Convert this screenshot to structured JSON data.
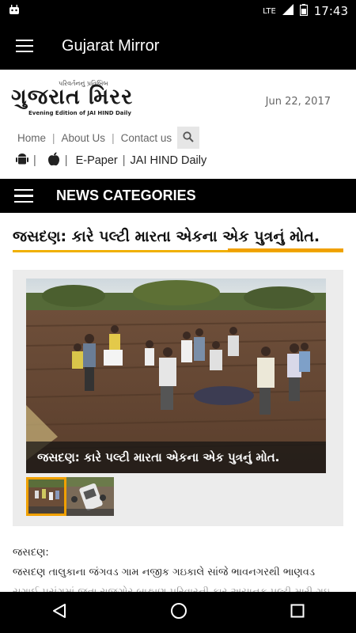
{
  "status_bar": {
    "network": "LTE",
    "time": "17:43"
  },
  "app_bar": {
    "title": "Gujarat Mirror"
  },
  "header": {
    "logo_tagline": "પરિવર્તનનું પ્રતિબિંબ",
    "logo_text": "ગુજરાત મિરર",
    "logo_subtitle": "Evening Edition of JAI HIND Daily",
    "date": "Jun 22, 2017",
    "nav": [
      {
        "label": "Home"
      },
      {
        "label": "About Us"
      },
      {
        "label": "Contact us"
      }
    ],
    "apps": {
      "epaper": "E-Paper",
      "jaihind": "JAI HIND Daily"
    }
  },
  "category_bar": {
    "label": "NEWS CATEGORIES"
  },
  "article": {
    "headline": "જસદણ: કારે પલ્ટી મારતા એકના એક પુત્રનું મોત.",
    "caption": "જસદણ: કારે પલ્ટી મારતા એકના એક પુત્રનું મોત.",
    "dateline": "જસદણ:",
    "line1": "જસદણ તાલુકાના જંગવડ ગામ નજીક ગઇકાલે સાંજે ભાવનગરથી ભાણવડ",
    "line2": "સગાઈ પ્રસંગમાં જતા રાજગોર બ્રાહ્મણ પરિવારની કાર અચાનક પલ્ટી મારી ગઇ"
  },
  "colors": {
    "accent": "#f0a000",
    "bar": "#000000"
  }
}
